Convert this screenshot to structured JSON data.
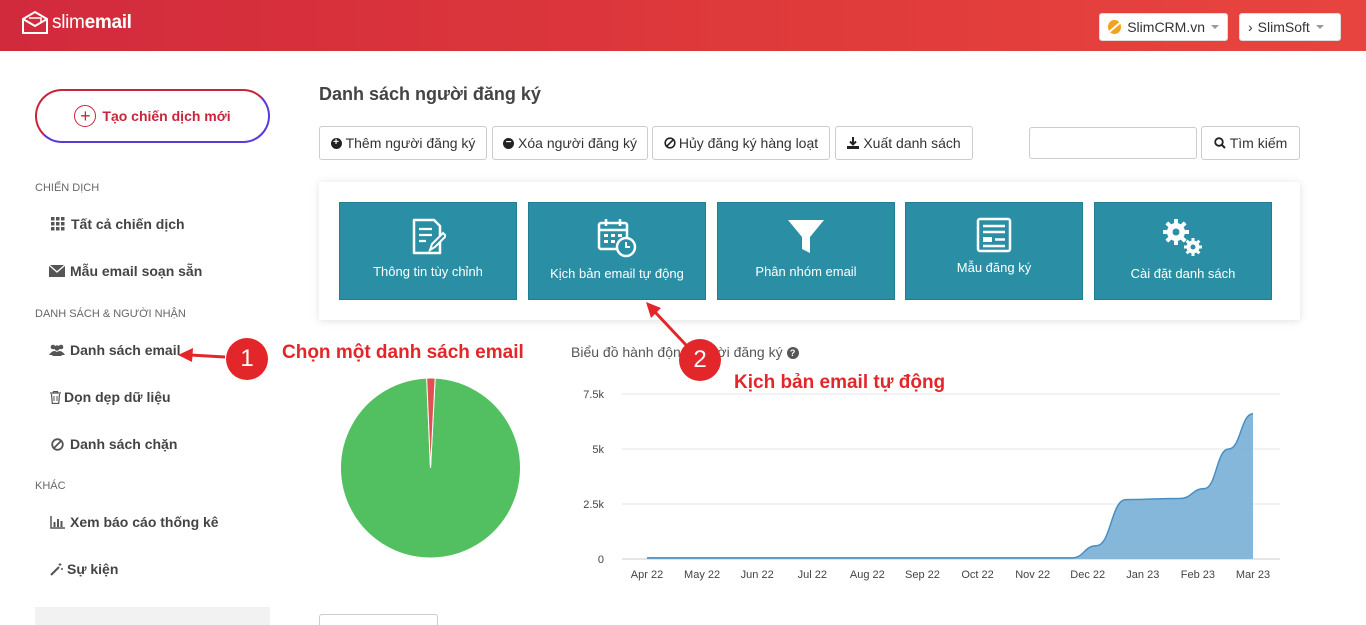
{
  "header": {
    "logo_light": "slim",
    "logo_bold": "email",
    "crm_button": "SlimCRM.vn",
    "soft_button": "SlimSoft"
  },
  "sidebar": {
    "create_button": "Tạo chiến dịch mới",
    "sections": [
      {
        "label": "CHIẾN DỊCH",
        "items": [
          {
            "label": "Tất cả chiến dịch",
            "icon": "grid-icon"
          },
          {
            "label": "Mẫu email soạn sẵn",
            "icon": "envelope-icon"
          }
        ]
      },
      {
        "label": "DANH SÁCH & NGƯỜI NHẬN",
        "items": [
          {
            "label": "Danh sách email",
            "icon": "users-icon"
          },
          {
            "label": "Dọn dẹp dữ liệu",
            "icon": "trash-icon"
          },
          {
            "label": "Danh sách chặn",
            "icon": "ban-icon"
          }
        ]
      },
      {
        "label": "KHÁC",
        "items": [
          {
            "label": "Xem báo cáo thống kê",
            "icon": "bar-chart-icon"
          },
          {
            "label": "Sự kiện",
            "icon": "magic-wand-icon"
          }
        ]
      }
    ]
  },
  "main": {
    "title": "Danh sách người đăng ký",
    "toolbar": {
      "add": "Thêm người đăng ký",
      "remove": "Xóa người đăng ký",
      "unsubscribe": "Hủy đăng ký hàng loạt",
      "export": "Xuất danh sách",
      "search_value": "",
      "search_button": "Tìm kiếm"
    },
    "tiles": [
      {
        "label": "Thông tin tùy chỉnh",
        "icon": "edit-document-icon"
      },
      {
        "label": "Kịch bản email tự động",
        "icon": "calendar-clock-icon"
      },
      {
        "label": "Phân nhóm email",
        "icon": "funnel-icon"
      },
      {
        "label": "Mẫu đăng ký",
        "icon": "form-icon"
      },
      {
        "label": "Cài đặt danh sách",
        "icon": "gears-icon"
      }
    ],
    "chart_title": "Biểu đồ hành động người đăng ký"
  },
  "annotations": {
    "badge1": "1",
    "text1": "Chọn một danh sách email",
    "badge2": "2",
    "text2": "Kịch bản email tự động"
  },
  "colors": {
    "header": "#d22a3d",
    "tile": "#2a8fa4",
    "annotation": "#e3262a",
    "pie_main": "#52c060",
    "pie_small": "#e05050",
    "area": "#7eb3d8"
  },
  "chart_data": [
    {
      "type": "pie",
      "slices": [
        {
          "value": 98.5,
          "color": "#52c060"
        },
        {
          "value": 1.5,
          "color": "#e05050"
        }
      ]
    },
    {
      "type": "area",
      "categories": [
        "Apr 22",
        "May 22",
        "Jun 22",
        "Jul 22",
        "Aug 22",
        "Sep 22",
        "Oct 22",
        "Nov 22",
        "Dec 22",
        "Jan 23",
        "Feb 23",
        "Mar 23"
      ],
      "x": [
        "2022-04-01",
        "2022-05-01",
        "2022-06-01",
        "2022-07-01",
        "2022-08-01",
        "2022-09-01",
        "2022-10-01",
        "2022-11-01",
        "2022-12-01",
        "2022-12-15",
        "2023-01-01",
        "2023-02-01",
        "2023-02-15",
        "2023-03-01",
        "2023-03-15"
      ],
      "values": [
        50,
        50,
        50,
        50,
        50,
        50,
        50,
        50,
        50,
        600,
        2700,
        2750,
        3200,
        5000,
        6600
      ],
      "yticks": [
        "0",
        "2.5k",
        "5k",
        "7.5k"
      ],
      "ylim": [
        0,
        7500
      ],
      "grid": true
    }
  ]
}
